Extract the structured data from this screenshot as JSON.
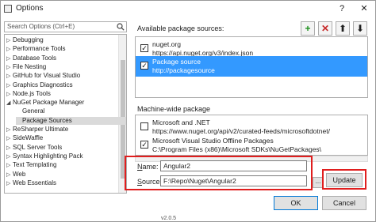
{
  "window": {
    "title": "Options",
    "help_label": "?",
    "close_label": "✕"
  },
  "search": {
    "placeholder": "Search Options (Ctrl+E)"
  },
  "tree": {
    "items": [
      {
        "label": "Debugging",
        "arrow": "▷"
      },
      {
        "label": "Performance Tools",
        "arrow": "▷"
      },
      {
        "label": "Database Tools",
        "arrow": "▷"
      },
      {
        "label": "File Nesting",
        "arrow": "▷"
      },
      {
        "label": "GitHub for Visual Studio",
        "arrow": "▷"
      },
      {
        "label": "Graphics Diagnostics",
        "arrow": "▷"
      },
      {
        "label": "Node.js Tools",
        "arrow": "▷"
      },
      {
        "label": "NuGet Package Manager",
        "arrow": "◢"
      },
      {
        "label": "General",
        "arrow": ""
      },
      {
        "label": "Package Sources",
        "arrow": ""
      },
      {
        "label": "ReSharper Ultimate",
        "arrow": "▷"
      },
      {
        "label": "SideWaffle",
        "arrow": "▷"
      },
      {
        "label": "SQL Server Tools",
        "arrow": "▷"
      },
      {
        "label": "Syntax Highlighting Pack",
        "arrow": "▷"
      },
      {
        "label": "Text Templating",
        "arrow": "▷"
      },
      {
        "label": "Web",
        "arrow": "▷"
      },
      {
        "label": "Web Essentials",
        "arrow": "▷"
      }
    ],
    "selected": "Package Sources"
  },
  "available": {
    "heading": "Available package sources:",
    "sources": [
      {
        "name": "nuget.org",
        "url": "https://api.nuget.org/v3/index.json",
        "checked": true
      },
      {
        "name": "Package source",
        "url": "http://packagesource",
        "checked": true
      }
    ]
  },
  "toolbar": {
    "add_icon": "+",
    "remove_icon": "✕",
    "up_icon": "⬆",
    "down_icon": "⬇"
  },
  "machine": {
    "heading": "Machine-wide package",
    "sources": [
      {
        "name": "Microsoft and .NET",
        "url": "https://www.nuget.org/api/v2/curated-feeds/microsoftdotnet/",
        "checked": false
      },
      {
        "name": "Microsoft Visual Studio Offline Packages",
        "url": "C:\\Program Files (x86)\\Microsoft SDKs\\NuGetPackages\\",
        "checked": true
      }
    ]
  },
  "form": {
    "name_label_ul": "N",
    "name_label_rest": "ame:",
    "name_value": "Angular2",
    "source_label_ul": "S",
    "source_label_rest": "ource:",
    "source_value": "F:\\Repo\\Nuget\\Angular2",
    "browse_label": "...",
    "update_label": "Update"
  },
  "footer": {
    "ok_label": "OK",
    "cancel_label": "Cancel",
    "version": "v2.0.5"
  },
  "colors": {
    "selection": "#3399ff",
    "highlight_box": "#e01e1e",
    "add_green": "#1a8f1a",
    "remove_red": "#c62828"
  }
}
